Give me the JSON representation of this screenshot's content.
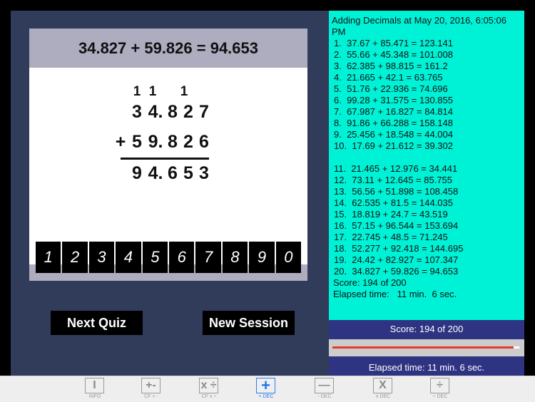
{
  "quiz": {
    "equation": "34.827 + 59.826 = 94.653",
    "carries": [
      "1",
      "1",
      "",
      "1",
      "",
      ""
    ],
    "addend1": [
      "3",
      "4.",
      "8",
      "2",
      "7"
    ],
    "operator": "+",
    "addend2": [
      "5",
      "9.",
      "8",
      "2",
      "6"
    ],
    "sum": [
      "9",
      "4.",
      "6",
      "5",
      "3"
    ]
  },
  "keypad": [
    "1",
    "2",
    "3",
    "4",
    "5",
    "6",
    "7",
    "8",
    "9",
    "0"
  ],
  "buttons": {
    "next_quiz": "Next Quiz",
    "new_session": "New Session"
  },
  "results": {
    "title": "Adding Decimals at May 20, 2016, 6:05:06 PM",
    "items_1_10": [
      "1.  37.67 + 85.471 = 123.141",
      "2.  55.66 + 45.348 = 101.008",
      "3.  62.385 + 98.815 = 161.2",
      "4.  21.665 + 42.1 = 63.765",
      "5.  51.76 + 22.936 = 74.696",
      "6.  99.28 + 31.575 = 130.855",
      "7.  67.987 + 16.827 = 84.814",
      "8.  91.86 + 66.288 = 158.148",
      "9.  25.456 + 18.548 = 44.004",
      "10.  17.69 + 21.612 = 39.302"
    ],
    "items_11_20": [
      "11.  21.465 + 12.976 = 34.441",
      "12.  73.11 + 12.645 = 85.755",
      "13.  56.56 + 51.898 = 108.458",
      "14.  62.535 + 81.5 = 144.035",
      "15.  18.819 + 24.7 = 43.519",
      "16.  57.15 + 96.544 = 153.694",
      "17.  22.745 + 48.5 = 71.245",
      "18.  52.277 + 92.418 = 144.695",
      "19.  24.42 + 82.927 = 107.347",
      "20.  34.827 + 59.826 = 94.653"
    ],
    "score": "Score: 194 of 200",
    "elapsed": "Elapsed time:   11 min.  6 sec."
  },
  "status": {
    "score": "Score: 194 of 200",
    "progress_fraction": 0.97,
    "elapsed": "Elapsed time:   11 min.  6 sec."
  },
  "colors": {
    "accent": "#00f2d6",
    "progress": "#e8362b",
    "active_tab": "#2a7ef0"
  },
  "tabs": [
    {
      "icon": "I",
      "icon_name": "info-icon",
      "label": "INFO"
    },
    {
      "icon": "+-",
      "icon_name": "plus-minus-icon",
      "label": "CF + -"
    },
    {
      "icon": "x ÷",
      "icon_name": "multiply-divide-icon",
      "label": "CF x ÷"
    },
    {
      "icon": "+",
      "icon_name": "plus-icon",
      "label": "+ DEC",
      "active": true
    },
    {
      "icon": "—",
      "icon_name": "minus-icon",
      "label": "- DEC"
    },
    {
      "icon": "X",
      "icon_name": "multiply-icon",
      "label": "x DEC"
    },
    {
      "icon": "÷",
      "icon_name": "divide-icon",
      "label": "÷ DEC"
    }
  ]
}
